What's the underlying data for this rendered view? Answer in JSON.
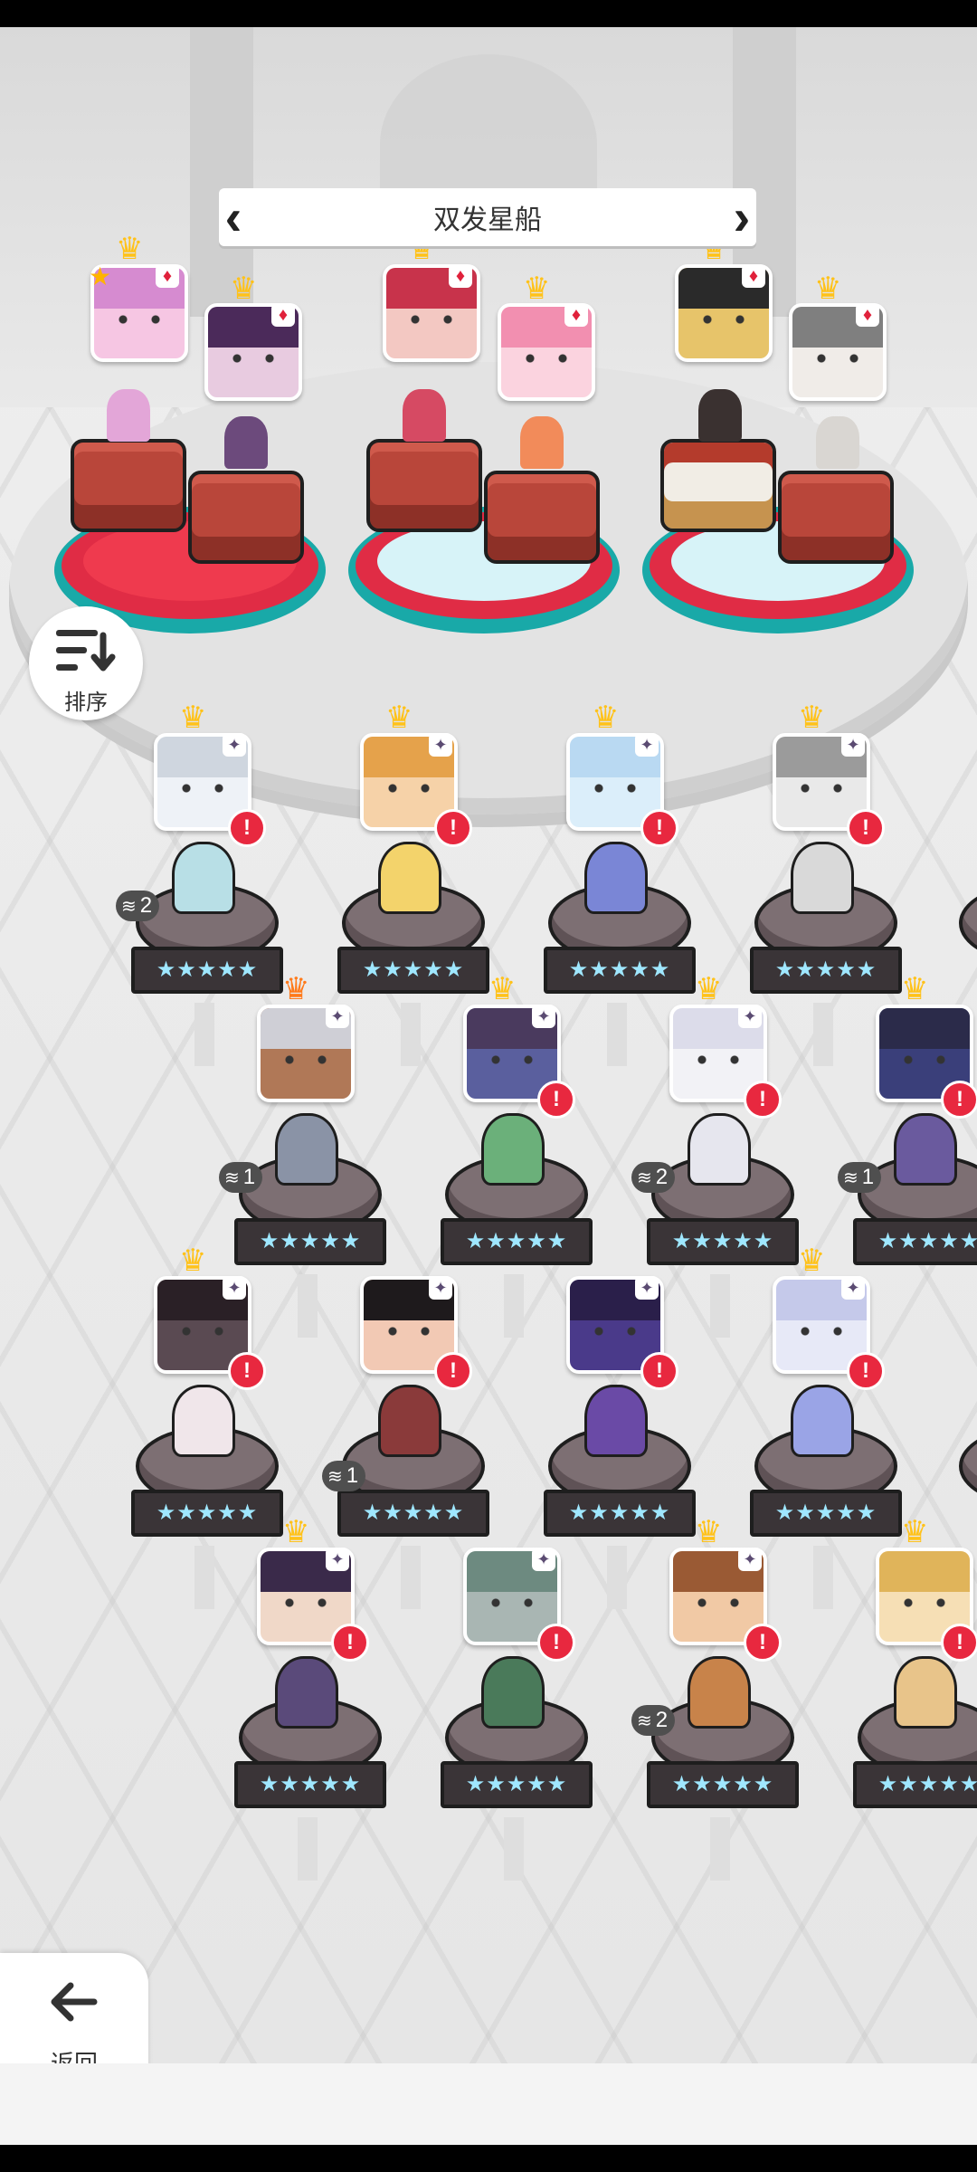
{
  "ship": {
    "title": "双发星船"
  },
  "controls": {
    "sort_label": "排序",
    "back_label": "返回"
  },
  "icons": {
    "sort": "sort-icon",
    "back": "back-arrow-icon",
    "prev": "chevron-left-icon",
    "next": "chevron-right-icon",
    "alert": "exclamation-icon",
    "crown": "crown-icon",
    "suit": "diamond-suit-icon",
    "rank": "rank-emblem-icon",
    "stack": "stack-icon"
  },
  "colors": {
    "alert": "#e8283f",
    "crown": "#ffc21a",
    "crown_orange": "#ff7a1a",
    "pedestal_red": "#e02c45",
    "pedestal_teal": "#19a9a8"
  },
  "symbols": {
    "alert": "!",
    "crown": "♛",
    "suit": "♦",
    "rank": "✦",
    "star": "★",
    "stars_row": "★★★★★",
    "stack": "≋"
  },
  "counts": {
    "c1": "2",
    "c2": "2",
    "c3": "1",
    "c4": "2",
    "c5": "1",
    "c6": "1",
    "c7": "2"
  }
}
